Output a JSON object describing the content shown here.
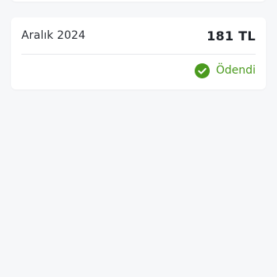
{
  "invoice": {
    "period": "Aralık 2024",
    "amount": "181 TL",
    "status_label": "Ödendi",
    "status_icon": "check-circle-icon",
    "status_color": "#4a9a1e"
  }
}
